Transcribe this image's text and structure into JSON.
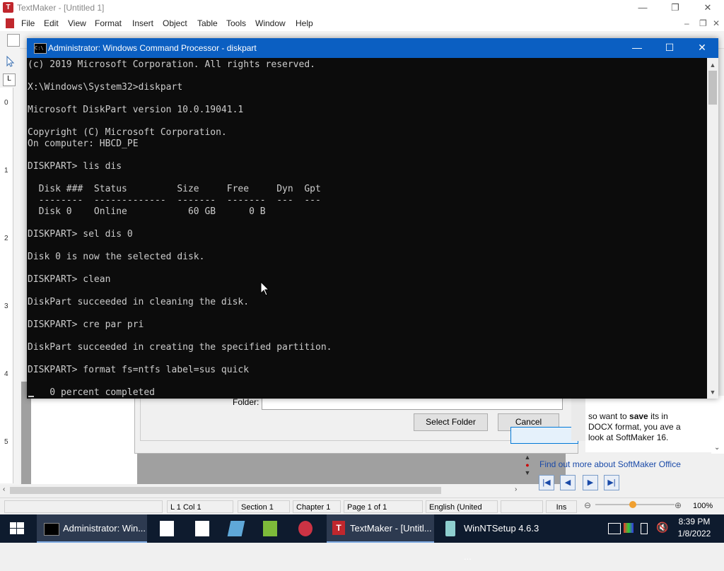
{
  "textmaker": {
    "title": "TextMaker - [Untitled 1]",
    "app_icon_letter": "T",
    "menu": [
      "File",
      "Edit",
      "View",
      "Format",
      "Insert",
      "Object",
      "Table",
      "Tools",
      "Window",
      "Help"
    ],
    "ruler_numbers": [
      "0",
      "1",
      "2",
      "3",
      "4",
      "5"
    ],
    "tab_stop_glyph": "L",
    "status": {
      "position": "L 1 Col 1",
      "section": "Section 1",
      "chapter": "Chapter 1",
      "page": "Page 1 of 1",
      "language": "English (United",
      "mode": "Ins",
      "zoom": "100%"
    }
  },
  "folder_dialog": {
    "folder_label": "Folder:",
    "folder_value": "",
    "select_button": "Select Folder",
    "cancel_button": "Cancel"
  },
  "side_panel": {
    "text_prefix": "so want to ",
    "text_bold": "save",
    "text_rest": "its in DOCX format, you ave a look at SoftMaker 16.",
    "link": "Find out more about SoftMaker Office"
  },
  "cmd": {
    "title": "Administrator: Windows Command Processor - diskpart",
    "lines": [
      "(c) 2019 Microsoft Corporation. All rights reserved.",
      "",
      "X:\\Windows\\System32>diskpart",
      "",
      "Microsoft DiskPart version 10.0.19041.1",
      "",
      "Copyright (C) Microsoft Corporation.",
      "On computer: HBCD_PE",
      "",
      "DISKPART> lis dis",
      "",
      "  Disk ###  Status         Size     Free     Dyn  Gpt",
      "  --------  -------------  -------  -------  ---  ---",
      "  Disk 0    Online           60 GB      0 B",
      "",
      "DISKPART> sel dis 0",
      "",
      "Disk 0 is now the selected disk.",
      "",
      "DISKPART> clean",
      "",
      "DiskPart succeeded in cleaning the disk.",
      "",
      "DISKPART> cre par pri",
      "",
      "DiskPart succeeded in creating the specified partition.",
      "",
      "DISKPART> format fs=ntfs label=sus quick",
      "",
      "    0 percent completed"
    ]
  },
  "taskbar": {
    "apps": [
      {
        "label": "Administrator: Win...",
        "active": true
      },
      {
        "label": "TextMaker - [Untitl...",
        "active": true
      },
      {
        "label": "WinNTSetup 4.6.3  ...",
        "active": false
      }
    ],
    "time": "8:39 PM",
    "date": "1/8/2022"
  },
  "colors": {
    "cmd_titlebar": "#0b5fc2",
    "cmd_background": "#0c0c0c",
    "cmd_text": "#cccccc",
    "taskbar": "#0e1b2e"
  }
}
